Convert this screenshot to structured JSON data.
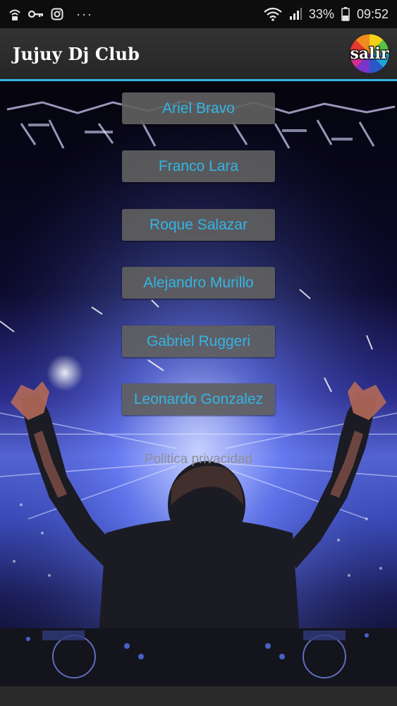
{
  "status_bar": {
    "battery_percent": "33%",
    "time": "09:52",
    "overflow_dots": "···",
    "icons": [
      "wifi-lock-icon",
      "key-icon",
      "instagram-icon",
      "more-icon",
      "wifi-icon",
      "signal-icon",
      "battery-icon"
    ]
  },
  "app_bar": {
    "title": "Jujuy Dj Club",
    "exit_label": "salir"
  },
  "buttons": [
    {
      "label": "Ariel Bravo"
    },
    {
      "label": "Franco Lara"
    },
    {
      "label": "Roque Salazar"
    },
    {
      "label": "Alejandro Murillo"
    },
    {
      "label": "Gabriel Ruggeri"
    },
    {
      "label": "Leonardo Gonzalez"
    }
  ],
  "privacy_link": "Politica privacidad",
  "colors": {
    "accent": "#33b5e5",
    "button_bg": "#606060",
    "app_bar_bg": "#2c2c2c",
    "status_bar_bg": "#0d0d0d"
  }
}
